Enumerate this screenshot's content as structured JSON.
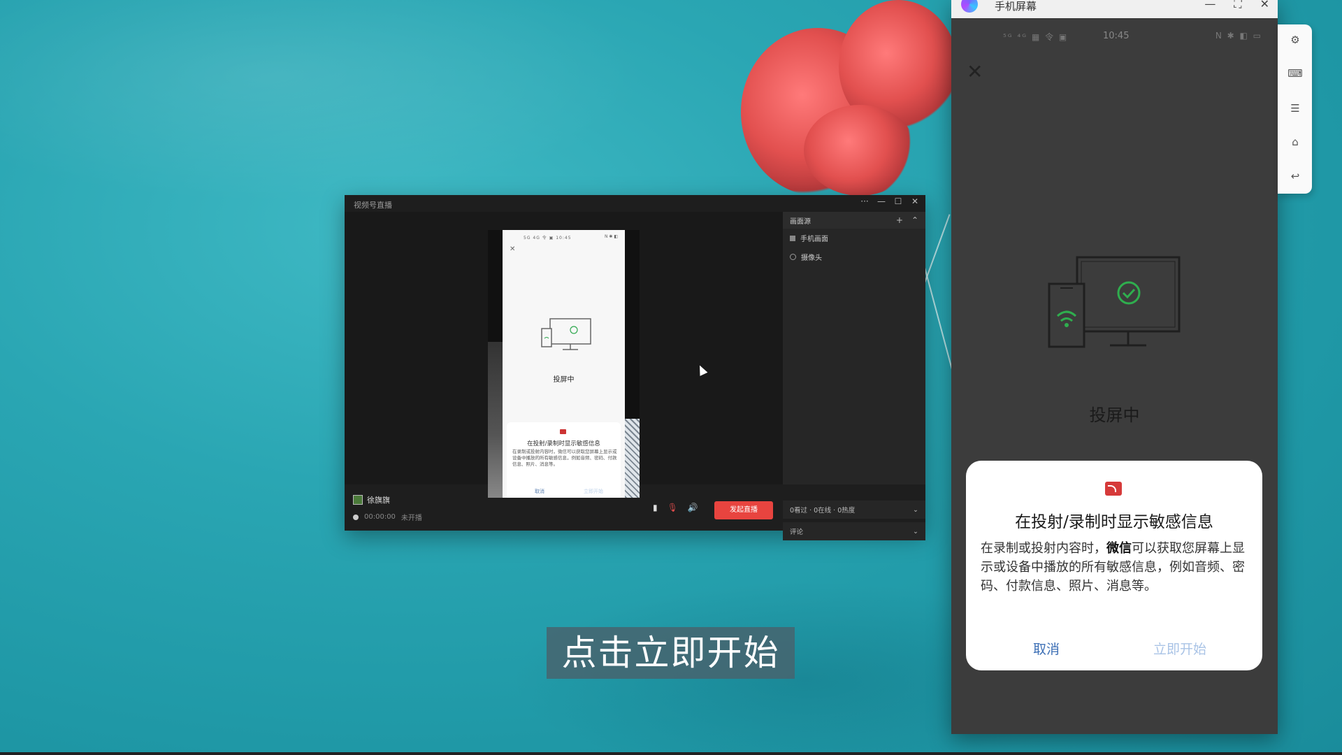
{
  "desktop": {
    "subtitle": "点击立即开始"
  },
  "live_window": {
    "title": "视频号直播",
    "controls": {
      "more": "···",
      "minimize": "—",
      "maximize": "☐",
      "close": "✕"
    },
    "mirror_preview": {
      "status_left": "5G 4G 令 ▣ 10:45",
      "status_right": "N ✱ ◧",
      "close": "✕",
      "caption": "投屏中",
      "dialog_title": "在投射/录制时显示敏感信息",
      "dialog_body": "在录制或投射内容时，微信可以获取您屏幕上显示或设备中播放的所有敏感信息，例如音频、密码、付款信息、照片、消息等。",
      "cancel": "取消",
      "start": "立即开始"
    },
    "host": {
      "name": "徐旗旗",
      "timer": "00:00:00",
      "state": "未开播"
    },
    "start_button": "发起直播",
    "sources": {
      "header": "画面源",
      "add": "+",
      "collapse": "⌃",
      "items": [
        {
          "label": "手机画面"
        },
        {
          "label": "摄像头"
        }
      ]
    },
    "stats": "0看过 · 0在线 · 0热度",
    "comments": "评论"
  },
  "mirror_window": {
    "title": "手机屏幕",
    "controls": {
      "minimize": "—",
      "fullscreen": "⛶",
      "close": "✕"
    },
    "status_left": "⁵ᴳ ⁴ᴳ ▦ 令 ▣",
    "time": "10:45",
    "status_right": "N ✱ ◧ ▭",
    "close": "✕",
    "caption": "投屏中",
    "dialog": {
      "title": "在投射/录制时显示敏感信息",
      "body_pre": "在录制或投射内容时，",
      "body_app": "微信",
      "body_post": "可以获取您屏幕上显示或设备中播放的所有敏感信息，例如音频、密码、付款信息、照片、消息等。",
      "cancel": "取消",
      "start": "立即开始"
    }
  },
  "side_tools": {
    "settings": "⚙",
    "keyboard": "⌨",
    "menu": "☰",
    "home": "⌂",
    "back": "↩"
  },
  "colors": {
    "accent_red": "#e8443f",
    "link_blue": "#3d6fb5",
    "disabled_blue": "#a9c3e6"
  }
}
